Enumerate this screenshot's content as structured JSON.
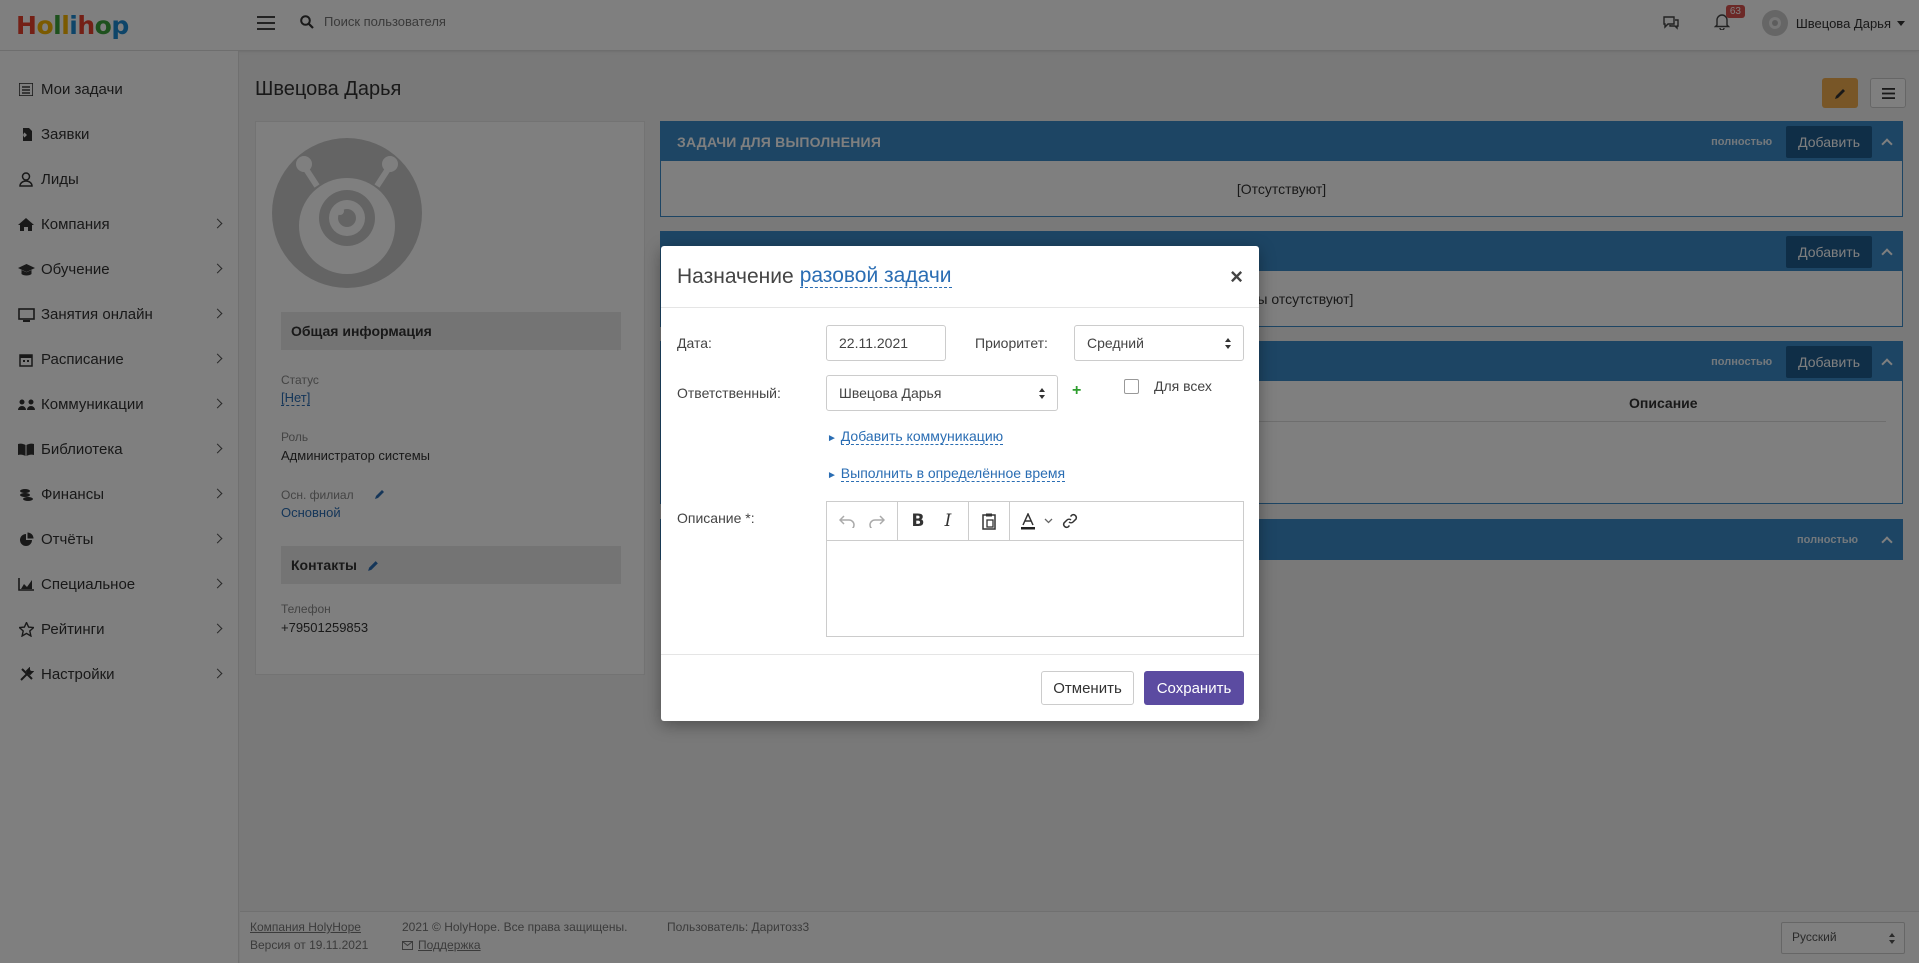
{
  "app": {
    "logo": {
      "letters": [
        "H",
        "o",
        "l",
        "l",
        "i",
        "h",
        "o",
        "p"
      ],
      "colors": [
        "#e8412c",
        "#f7b500",
        "#3ca33a",
        "#f7b500",
        "#1c8ad3",
        "#e8412c",
        "#3ca33a",
        "#1c8ad3"
      ]
    },
    "search_placeholder": "Поиск пользователя",
    "notifications_count": "63",
    "user_name": "Швецова Дарья"
  },
  "sidebar": {
    "items": [
      {
        "label": "Мои задачи",
        "icon": "list-icon"
      },
      {
        "label": "Заявки",
        "icon": "file-import-icon"
      },
      {
        "label": "Лиды",
        "icon": "user-icon"
      },
      {
        "label": "Компания",
        "icon": "home-icon"
      },
      {
        "label": "Обучение",
        "icon": "graduation-cap-icon"
      },
      {
        "label": "Занятия онлайн",
        "icon": "monitor-icon"
      },
      {
        "label": "Расписание",
        "icon": "calendar-icon"
      },
      {
        "label": "Коммуникации",
        "icon": "communication-icon"
      },
      {
        "label": "Библиотека",
        "icon": "book-icon"
      },
      {
        "label": "Финансы",
        "icon": "coins-icon"
      },
      {
        "label": "Отчёты",
        "icon": "pie-chart-icon"
      },
      {
        "label": "Специальное",
        "icon": "area-chart-icon"
      },
      {
        "label": "Рейтинги",
        "icon": "star-icon"
      },
      {
        "label": "Настройки",
        "icon": "tools-icon"
      }
    ]
  },
  "page": {
    "title": "Швецова Дарья",
    "profile": {
      "general_header": "Общая информация",
      "status_label": "Статус",
      "status_value": "[Нет]",
      "role_label": "Роль",
      "role_value": "Администратор системы",
      "branch_label": "Осн. филиал",
      "branch_value": "Основной",
      "contacts_header": "Контакты",
      "phone_label": "Телефон",
      "phone_value": "+79501259853"
    },
    "panels": [
      {
        "title": "ЗАДАЧИ ДЛЯ ВЫПОЛНЕНИЯ",
        "full": "полностью",
        "add": "Добавить",
        "body": "[Отсутствуют]"
      },
      {
        "title": "",
        "full": "",
        "add": "Добавить",
        "body": "ты отсутствуют]"
      },
      {
        "title": "",
        "full": "полностью",
        "add": "Добавить",
        "column": "Описание"
      },
      {
        "title": "",
        "full": "полностью",
        "add": ""
      }
    ]
  },
  "footer": {
    "company": "Компания HolyHope",
    "version": "Версия от 19.11.2021",
    "copyright": "2021 © HolyHope. Все права защищены.",
    "support": "Поддержка",
    "user": "Пользователь: Даритозз3",
    "language": "Русский"
  },
  "modal": {
    "title": "Назначение",
    "title_link": "разовой задачи",
    "date_label": "Дата:",
    "date_value": "22.11.2021",
    "priority_label": "Приоритет:",
    "priority_value": "Средний",
    "responsible_label": "Ответственный:",
    "responsible_value": "Швецова Дарья",
    "plus": "+",
    "for_all_label": "Для всех",
    "add_communication": "Добавить коммуникацию",
    "execute_time": "Выполнить в определённое время",
    "description_label": "Описание *:",
    "cancel": "Отменить",
    "save": "Сохранить",
    "close": "×"
  }
}
